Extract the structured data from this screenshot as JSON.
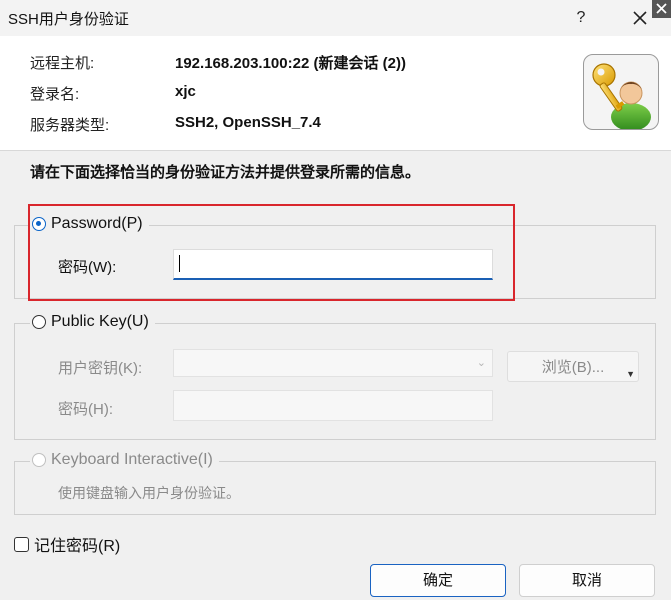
{
  "window": {
    "title": "SSH用户身份验证",
    "help_label": "?",
    "close_icon": "close-icon"
  },
  "header": {
    "rows": [
      {
        "label": "远程主机:",
        "value": "192.168.203.100:22 (新建会话 (2))"
      },
      {
        "label": "登录名:",
        "value": "xjc"
      },
      {
        "label": "服务器类型:",
        "value": "SSH2, OpenSSH_7.4"
      }
    ],
    "icon": "key-user-icon"
  },
  "instruction": "请在下面选择恰当的身份验证方法并提供登录所需的信息。",
  "methods": {
    "password": {
      "label": "Password(P)",
      "selected": true,
      "field_label": "密码(W):",
      "value": ""
    },
    "public_key": {
      "label": "Public Key(U)",
      "selected": false,
      "key_label": "用户密钥(K):",
      "key_value": "",
      "browse_label": "浏览(B)...",
      "passphrase_label": "密码(H):",
      "passphrase_value": ""
    },
    "keyboard": {
      "label": "Keyboard Interactive(I)",
      "selected": false,
      "hint": "使用键盘输入用户身份验证。"
    }
  },
  "remember_password": {
    "label": "记住密码(R)",
    "checked": false
  },
  "buttons": {
    "ok": "确定",
    "cancel": "取消"
  },
  "colors": {
    "accent": "#1a63c2",
    "highlight": "#d9262c"
  }
}
